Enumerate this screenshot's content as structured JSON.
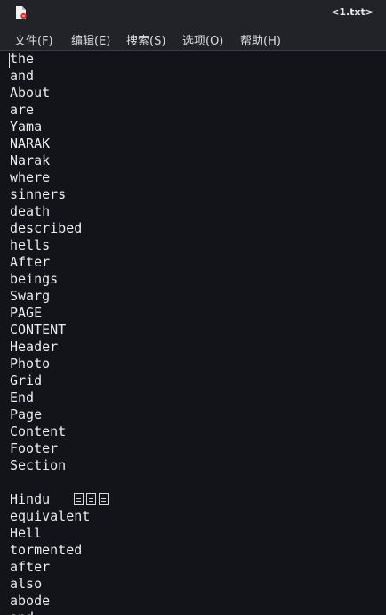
{
  "window": {
    "title": "<1.txt>",
    "icon": "document-icon"
  },
  "menu": {
    "items": [
      {
        "id": "file",
        "label": "文件(F)"
      },
      {
        "id": "edit",
        "label": "编辑(E)"
      },
      {
        "id": "search",
        "label": "搜索(S)"
      },
      {
        "id": "options",
        "label": "选项(O)"
      },
      {
        "id": "help",
        "label": "帮助(H)"
      }
    ]
  },
  "editor": {
    "lines": [
      "the",
      "and",
      "About",
      "are",
      "Yama",
      "NARAK",
      "Narak",
      "where",
      "sinners",
      "death",
      "described",
      "hells",
      "After",
      "beings",
      "Swarg",
      "PAGE",
      "CONTENT",
      "Header",
      "Photo",
      "Grid",
      "End",
      "Page",
      "Content",
      "Footer",
      "Section",
      "",
      "Hindu",
      "equivalent",
      "Hell",
      "tormented",
      "after",
      "also",
      "abode",
      "and"
    ],
    "box_glyph_line_count": 3
  },
  "colors": {
    "background": "#131419",
    "bar": "#222329",
    "text": "#ededed",
    "icon_accent": "#d93030"
  }
}
